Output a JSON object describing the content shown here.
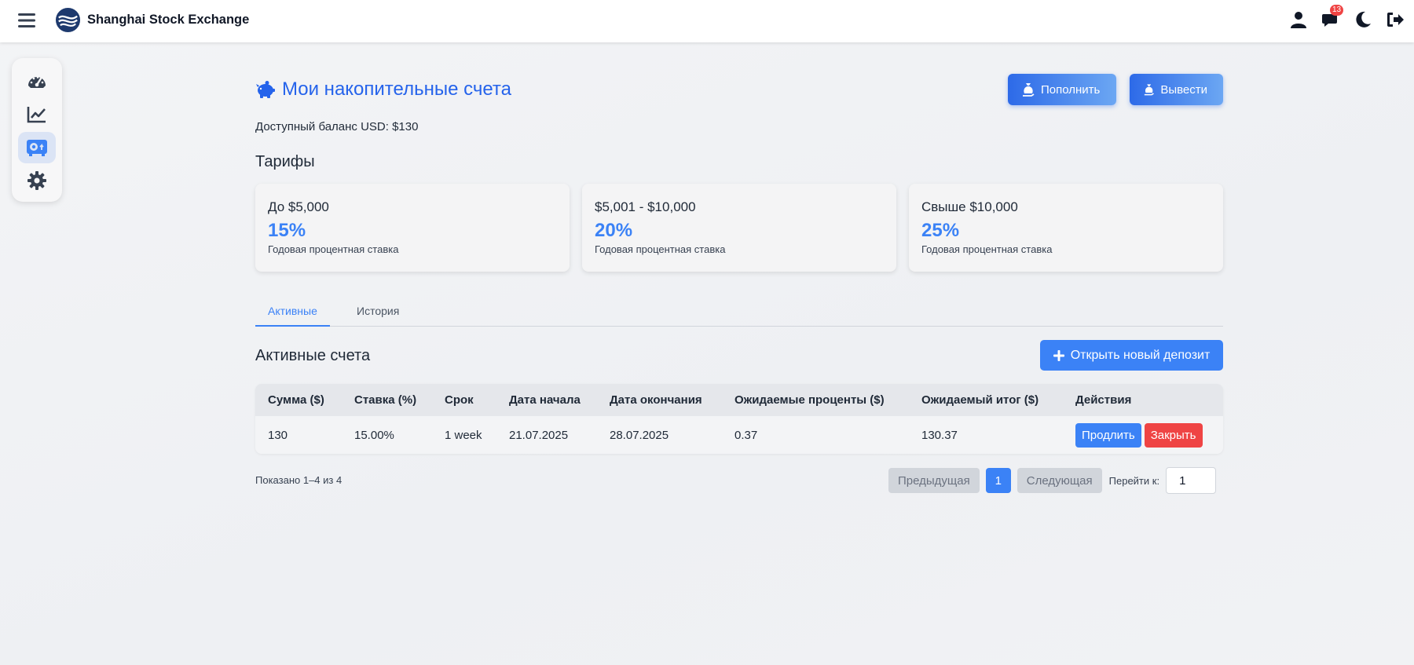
{
  "header": {
    "brand_name": "Shanghai Stock Exchange",
    "notification_count": "13"
  },
  "sidebar": {
    "items": [
      {
        "icon": "gauge-icon"
      },
      {
        "icon": "chart-line-icon"
      },
      {
        "icon": "vault-icon",
        "active": true
      },
      {
        "icon": "gear-icon"
      }
    ]
  },
  "page": {
    "title": "Мои накопительные счета",
    "deposit_label": "Пополнить",
    "withdraw_label": "Вывести",
    "balance": "Доступный баланс USD: $130"
  },
  "tariffs": {
    "title": "Тарифы",
    "cards": [
      {
        "range": "До $5,000",
        "rate": "15%",
        "caption": "Годовая процентная ставка"
      },
      {
        "range": "$5,001 - $10,000",
        "rate": "20%",
        "caption": "Годовая процентная ставка"
      },
      {
        "range": "Свыше $10,000",
        "rate": "25%",
        "caption": "Годовая процентная ставка"
      }
    ]
  },
  "tabs": [
    {
      "label": "Активные",
      "active": true
    },
    {
      "label": "История",
      "active": false
    }
  ],
  "accounts": {
    "title": "Активные счета",
    "new_deposit_label": "Открыть новый депозит",
    "columns": [
      "Сумма ($)",
      "Ставка (%)",
      "Срок",
      "Дата начала",
      "Дата окончания",
      "Ожидаемые проценты ($)",
      "Ожидаемый итог ($)",
      "Действия"
    ],
    "rows": [
      {
        "amount": "130",
        "rate": "15.00%",
        "term": "1 week",
        "start": "21.07.2025",
        "end": "28.07.2025",
        "interest": "0.37",
        "total": "130.37",
        "extend_label": "Продлить",
        "close_label": "Закрыть"
      }
    ]
  },
  "pagination": {
    "shown": "Показано 1–4 из 4",
    "prev_label": "Предыдущая",
    "current_page": "1",
    "next_label": "Следующая",
    "goto_label": "Перейти к:",
    "goto_value": "1"
  },
  "colors": {
    "accent": "#3b82f6",
    "title_blue": "#2563eb",
    "danger": "#ef4444"
  }
}
